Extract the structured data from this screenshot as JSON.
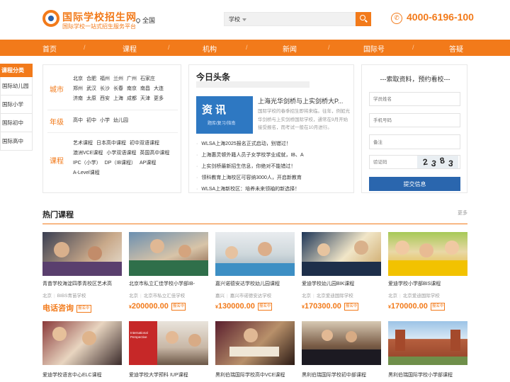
{
  "header": {
    "logo_title": "国际学校招生网",
    "logo_sub": "国际学校一站式招生服务平台",
    "location": "全国",
    "search_select": "学校",
    "search_placeholder": "",
    "phone": "4000-6196-100"
  },
  "nav": [
    "首页",
    "课程",
    "机构",
    "新闻",
    "国际号",
    "答疑"
  ],
  "sidebar": {
    "title": "课程分类",
    "items": [
      "国际幼儿园",
      "国际小学",
      "国际初中",
      "国际高中"
    ]
  },
  "filter": {
    "city_label": "城市",
    "cities_1": [
      "北京",
      "合肥",
      "福州",
      "兰州",
      "广州",
      "石家庄"
    ],
    "cities_2": [
      "郑州",
      "武汉",
      "长沙",
      "长春",
      "南京",
      "南昌",
      "大连"
    ],
    "cities_3": [
      "济南",
      "太原",
      "西安",
      "上海",
      "成都",
      "天津",
      "更多"
    ],
    "grade_label": "年级",
    "grades": [
      "高中",
      "初中",
      "小学",
      "幼儿园"
    ],
    "course_label": "课程",
    "courses_1": [
      "艺术课程",
      "日本高中课程",
      "初中双语课程"
    ],
    "courses_2": [
      "澳洲VCE课程",
      "小学双语课程",
      "英国高中课程"
    ],
    "courses_3": [
      "IPC（小学）",
      "DP（IB课程）",
      "AP课程"
    ],
    "courses_4": [
      "A-Level课程"
    ]
  },
  "news": {
    "title": "今日头条",
    "image_big": "资讯",
    "image_small": "题库/复习/指南",
    "headline": "上海光华剑桥与上实剑桥大P...",
    "desc": "国际学校的春季招生即将来临。往年，例如光华剑桥与上实剑桥国际学校，通常在9月开始接受报名，而考试一般在10月进行。",
    "items": [
      "WLSA上海2025报名正式启动，别错过！",
      "上海惠灵顿外籍人员子女学校学业成就，IB、A",
      "上实剑桥最新招生信息，你绝对不能错过！",
      "领科教育上海校区可容纳3000人，开启新教育",
      "WLSA上海新校区：培养未来领袖的新选择！"
    ]
  },
  "form": {
    "title": "---索取资料，预约看校---",
    "name_placeholder": "学员姓名",
    "phone_placeholder": "手机号码",
    "note_placeholder": "备注",
    "captcha_placeholder": "验证码",
    "captcha_chars": [
      "2",
      "3",
      "8",
      "3"
    ],
    "submit": "提交信息"
  },
  "hot": {
    "title": "热门课程",
    "more": "更多",
    "tag": "报名中",
    "row1": [
      {
        "name": "青苗学校海淀四季青校区艺术高",
        "city": "北京",
        "school": "BIBS青苗学校",
        "price": "电话咨询",
        "currency": ""
      },
      {
        "name": "北京市私立汇佳学校小学部IB-",
        "city": "北京",
        "school": "北京市私立汇佳学校",
        "price": "200000.00",
        "currency": "¥"
      },
      {
        "name": "嘉兴诺德安达学校幼儿园课程",
        "city": "嘉兴",
        "school": "嘉兴市诺德安达学校",
        "price": "130000.00",
        "currency": "¥"
      },
      {
        "name": "爱迪学校幼儿园BIK课程",
        "city": "北京",
        "school": "北京爱迪国际学校",
        "price": "170300.00",
        "currency": "¥"
      },
      {
        "name": "爱迪学校小学部BIS课程",
        "city": "北京",
        "school": "北京爱迪国际学校",
        "price": "170000.00",
        "currency": "¥"
      }
    ],
    "row2": [
      {
        "name": "爱迪学校语言中心ELC课程"
      },
      {
        "name": "爱迪学校大学预科 IUP课程"
      },
      {
        "name": "黑利伯瑞国际学校高中VCE课程"
      },
      {
        "name": "黑利伯瑞国际学校初中部课程"
      },
      {
        "name": "黑利伯瑞国际学校小学部课程"
      }
    ],
    "poster_text": "International Perspective"
  },
  "colors": {
    "accent": "#f27a1a",
    "button_blue": "#2a66ae",
    "news_image": "#2e78c2"
  }
}
